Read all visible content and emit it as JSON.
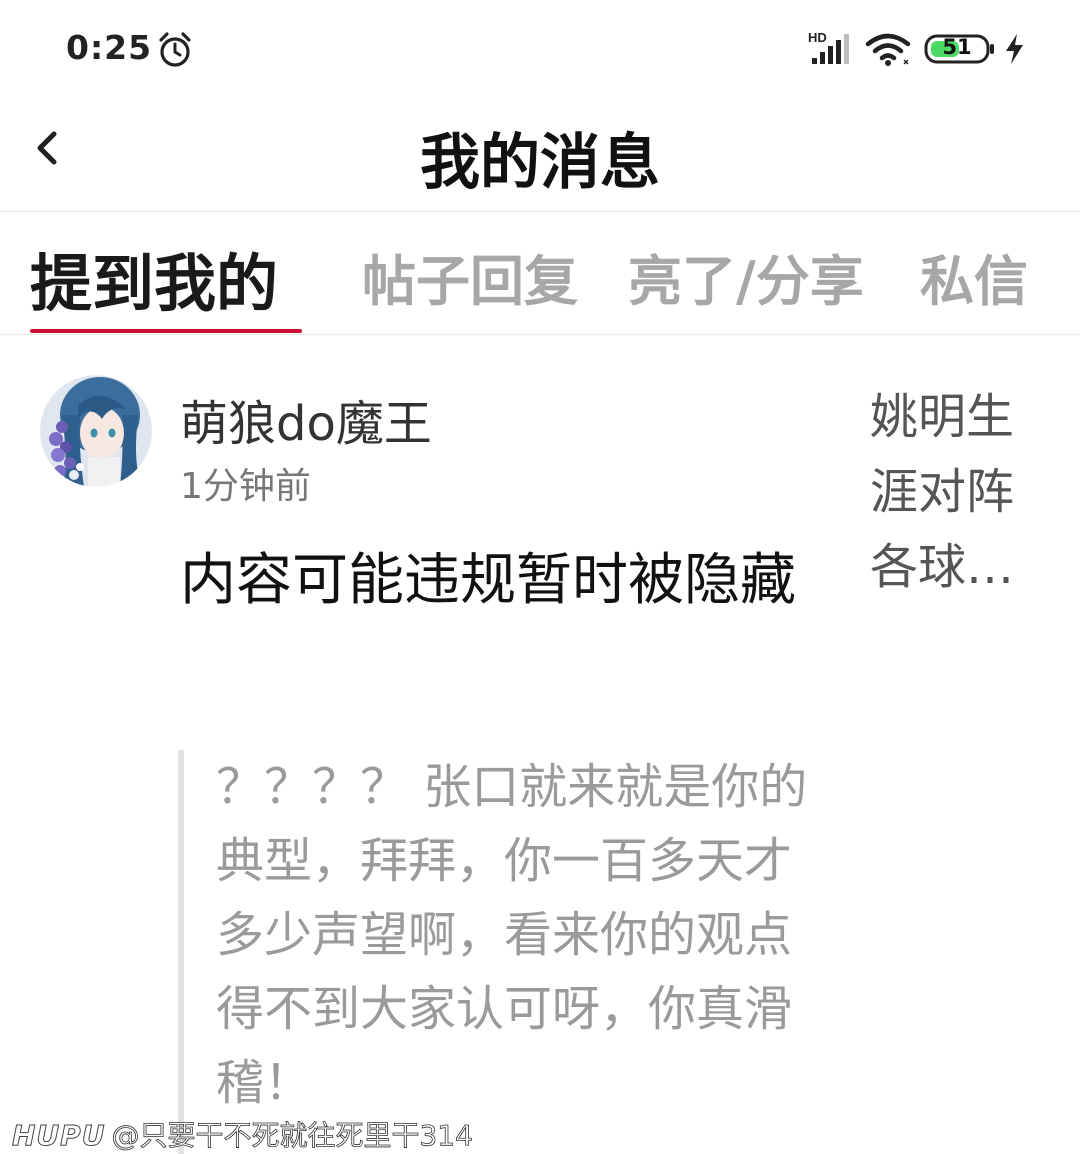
{
  "status_bar": {
    "time": "0:25",
    "battery": "51",
    "network_label": "HD"
  },
  "header": {
    "title": "我的消息"
  },
  "tabs": [
    {
      "label": "提到我的",
      "active": true
    },
    {
      "label": "帖子回复",
      "active": false
    },
    {
      "label": "亮了/分享",
      "active": false
    },
    {
      "label": "私信",
      "active": false
    }
  ],
  "message": {
    "username": "萌狼do魔王",
    "time_ago": "1分钟前",
    "content": "内容可能违规暂时被隐藏",
    "post_title": "姚明生涯对阵各球…",
    "quote": "？？？？ 张口就来就是你的典型，拜拜，你一百多天才多少声望啊，看来你的观点得不到大家认可呀，你真滑稽！"
  },
  "watermark": {
    "logo": "HUPU",
    "user": "@只要干不死就往死里干314"
  },
  "colors": {
    "accent": "#c8102e",
    "battery_fill": "#4cd964"
  }
}
